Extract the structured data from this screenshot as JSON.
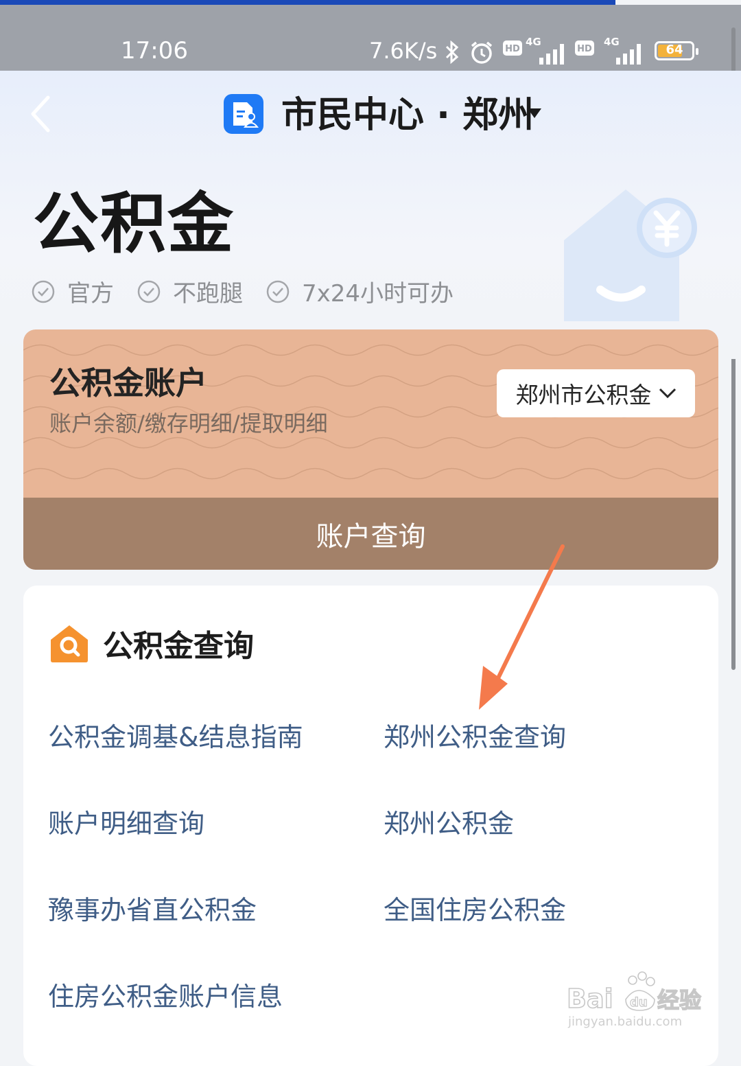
{
  "status_bar": {
    "time": "17:06",
    "net_speed": "7.6K/s",
    "battery": "64"
  },
  "nav": {
    "title": "市民中心 · 郑州"
  },
  "page": {
    "title": "公积金",
    "tags": [
      "官方",
      "不跑腿",
      "7x24小时可办"
    ]
  },
  "account_card": {
    "title": "公积金账户",
    "subtitle": "账户余额/缴存明细/提取明细",
    "city_select": "郑州市公积金",
    "action": "账户查询"
  },
  "query_section": {
    "title": "公积金查询",
    "links": [
      "公积金调基&结息指南",
      "郑州公积金查询",
      "账户明细查询",
      "郑州公积金",
      "豫事办省直公积金",
      "全国住房公积金",
      "住房公积金账户信息"
    ]
  },
  "watermark": {
    "brand": "Bai du 经验",
    "url": "jingyan.baidu.com"
  },
  "colors": {
    "accent_blue": "#1f7af5",
    "card_peach": "#e8b596",
    "card_footer": "#a38169",
    "link_blue": "#3f5d86",
    "arrow_orange": "#f47a4c",
    "section_icon_orange": "#f5922f"
  }
}
